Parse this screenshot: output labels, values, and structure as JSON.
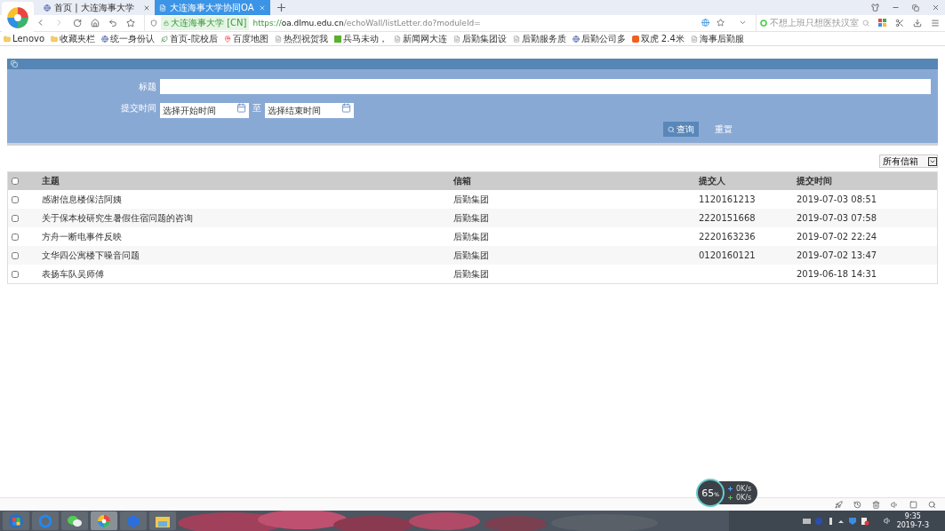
{
  "browser": {
    "tabs": [
      {
        "label": "首页 | 大连海事大学",
        "selected": false
      },
      {
        "label": "大连海事大学协同OA",
        "selected": true
      }
    ],
    "site_badge": "大连海事大学 [CN]",
    "url_scheme": "https://",
    "url_host": "oa.dlmu.edu.cn",
    "url_path": "/echoWall/listLetter.do?moduleId=",
    "search": {
      "placeholder": "不想上班只想医扶汉室"
    },
    "bookmarks": [
      {
        "label": "Lenovo",
        "kind": "folder"
      },
      {
        "label": "收藏夹栏",
        "kind": "folder"
      },
      {
        "label": "统一身份认",
        "kind": "globe"
      },
      {
        "label": "首页-院校后",
        "kind": "leaf"
      },
      {
        "label": "百度地图",
        "kind": "pin"
      },
      {
        "label": "热烈祝贺我",
        "kind": "page"
      },
      {
        "label": "兵马未动，",
        "kind": "green"
      },
      {
        "label": "新闻网大连",
        "kind": "page"
      },
      {
        "label": "后勤集团设",
        "kind": "page"
      },
      {
        "label": "后勤服务质",
        "kind": "page"
      },
      {
        "label": "后勤公司多",
        "kind": "globe"
      },
      {
        "label": "双虎 2.4米",
        "kind": "orange"
      },
      {
        "label": "海事后勤服",
        "kind": "page"
      }
    ]
  },
  "form": {
    "title_label": "标题",
    "time_label": "提交时间",
    "start": {
      "placeholder": "选择开始时间"
    },
    "to": "至",
    "end": {
      "placeholder": "选择结束时间"
    },
    "query_button": "查询",
    "reset_button": "重置"
  },
  "mailbox_select": "所有信箱",
  "table": {
    "columns": [
      "主题",
      "信箱",
      "提交人",
      "提交时间"
    ],
    "header_checked": false,
    "rows": [
      {
        "checked": false,
        "cells": [
          "感谢信息楼保洁阿姨",
          "后勤集团",
          "1120161213",
          "2019-07-03 08:51"
        ]
      },
      {
        "checked": false,
        "cells": [
          "关于保本校研究生暑假住宿问题的咨询",
          "后勤集团",
          "2220151668",
          "2019-07-03 07:58"
        ]
      },
      {
        "checked": false,
        "cells": [
          "方舟一断电事件反映",
          "后勤集团",
          "2220163236",
          "2019-07-02 22:24"
        ]
      },
      {
        "checked": false,
        "cells": [
          "文华四公寓楼下噪音问题",
          "后勤集团",
          "0120160121",
          "2019-07-02 13:47"
        ]
      },
      {
        "checked": false,
        "cells": [
          "表扬车队吴师傅",
          "后勤集团",
          "",
          "2019-06-18 14:31"
        ]
      }
    ]
  },
  "speed_widget": {
    "percent": "65",
    "unit": "%",
    "up": "0K/s",
    "down": "0K/s"
  },
  "taskbar": {
    "time": "9:35",
    "date": "2019-7-3"
  }
}
